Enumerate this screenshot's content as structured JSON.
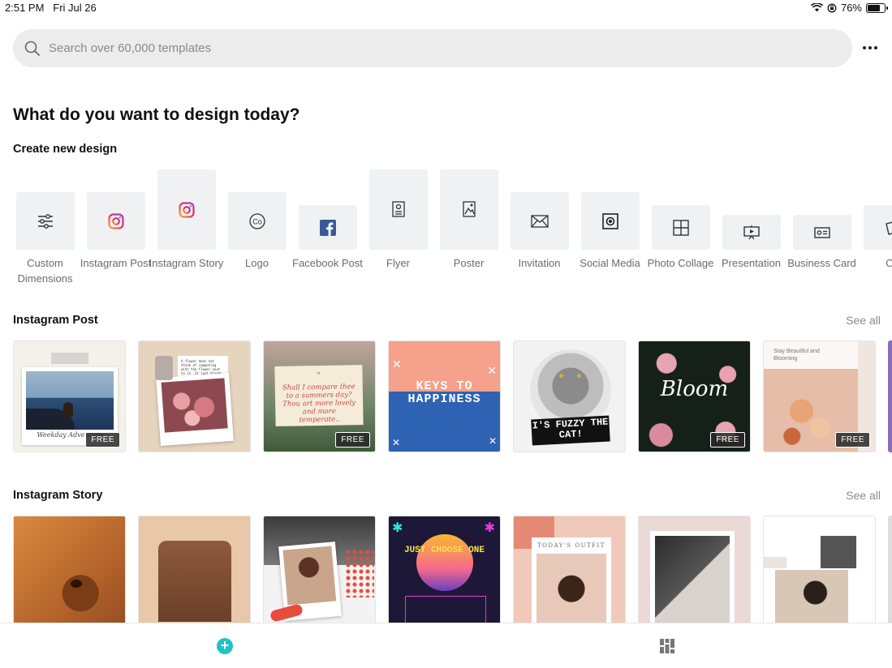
{
  "status": {
    "time": "2:51 PM",
    "date": "Fri Jul 26",
    "battery": "76%"
  },
  "search": {
    "placeholder": "Search over 60,000 templates"
  },
  "heading": "What do you want to design today?",
  "create_label": "Create new design",
  "types": [
    {
      "label": "Custom Dimensions",
      "icon": "sliders-icon"
    },
    {
      "label": "Instagram Post",
      "icon": "instagram-icon"
    },
    {
      "label": "Instagram Story",
      "icon": "instagram-icon"
    },
    {
      "label": "Logo",
      "icon": "logo-co-icon"
    },
    {
      "label": "Facebook Post",
      "icon": "facebook-icon"
    },
    {
      "label": "Flyer",
      "icon": "flyer-icon"
    },
    {
      "label": "Poster",
      "icon": "poster-icon"
    },
    {
      "label": "Invitation",
      "icon": "invitation-icon"
    },
    {
      "label": "Social Media",
      "icon": "social-media-icon"
    },
    {
      "label": "Photo Collage",
      "icon": "collage-icon"
    },
    {
      "label": "Presentation",
      "icon": "presentation-icon"
    },
    {
      "label": "Business Card",
      "icon": "business-card-icon"
    },
    {
      "label": "Ca",
      "icon": "card-icon"
    }
  ],
  "sections": {
    "instagram_post": {
      "title": "Instagram Post",
      "see_all": "See all",
      "cards": [
        {
          "text": "Weekday Adventure",
          "badge": "FREE"
        },
        {
          "text": "A flower does not think of competing with the flower next to it. It just blooms.",
          "badge": ""
        },
        {
          "text": "Shall I compare thee to a summers day? Thou art more lovely and more temperate..",
          "badge": "FREE"
        },
        {
          "text": "KEYS TO HAPPINESS",
          "badge": ""
        },
        {
          "text": "I'S FUZZY THE CAT!",
          "badge": ""
        },
        {
          "text": "Bloom",
          "badge": "FREE"
        },
        {
          "text": "Stay Beautiful and Blooming",
          "badge": "FREE"
        }
      ]
    },
    "instagram_story": {
      "title": "Instagram Story",
      "see_all": "See all",
      "cards": [
        {
          "text": ""
        },
        {
          "text": ""
        },
        {
          "text": ""
        },
        {
          "text": "JUST CHOOSE ONE"
        },
        {
          "text": "TODAY'S OUTFIT"
        },
        {
          "text": ""
        },
        {
          "text": ""
        }
      ]
    }
  },
  "colors": {
    "accent": "#1fc4c2",
    "tile_bg": "#f0f1f3",
    "facebook": "#3b5998"
  }
}
